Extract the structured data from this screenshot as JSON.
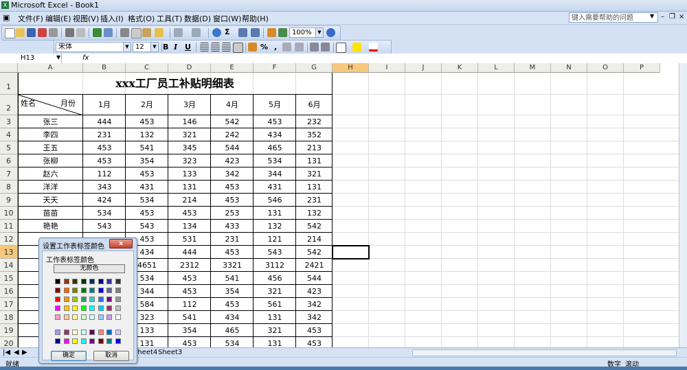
{
  "window": {
    "title": "Microsoft Excel - Book1"
  },
  "menu": {
    "items": [
      "文件(F)",
      "编辑(E)",
      "视图(V)",
      "插入(I)",
      "格式(O)",
      "工具(T)",
      "数据(D)",
      "窗口(W)",
      "帮助(H)"
    ],
    "help_placeholder": "键入需要帮助的问题"
  },
  "toolbar": {
    "zoom": "100%",
    "sum_icon": "Σ",
    "font_name": "宋体",
    "font_size": "12",
    "bold": "B",
    "italic": "I",
    "underline": "U",
    "percent": "%",
    "comma": ","
  },
  "formula_bar": {
    "name_box": "H13",
    "fx": "fx"
  },
  "columns": [
    "A",
    "B",
    "C",
    "D",
    "E",
    "F",
    "G",
    "H",
    "I",
    "J",
    "K",
    "L",
    "M",
    "N",
    "O",
    "P"
  ],
  "selected_column": "H",
  "rows": [
    "1",
    "2",
    "3",
    "4",
    "5",
    "6",
    "7",
    "8",
    "9",
    "10",
    "11",
    "12",
    "13",
    "14",
    "15",
    "16",
    "17",
    "18",
    "19",
    "20"
  ],
  "selected_row": "13",
  "sheet": {
    "title": "xxx工厂员工补贴明细表",
    "header_name": "姓名",
    "header_month": "月份",
    "month_headers": [
      "1月",
      "2月",
      "3月",
      "4月",
      "5月",
      "6月"
    ],
    "data": [
      [
        "张三",
        "444",
        "453",
        "146",
        "542",
        "453",
        "232"
      ],
      [
        "李四",
        "231",
        "132",
        "321",
        "242",
        "434",
        "352"
      ],
      [
        "王五",
        "453",
        "541",
        "345",
        "544",
        "465",
        "213"
      ],
      [
        "张柳",
        "453",
        "354",
        "323",
        "423",
        "534",
        "131"
      ],
      [
        "赵六",
        "112",
        "453",
        "133",
        "342",
        "344",
        "321"
      ],
      [
        "洋洋",
        "343",
        "431",
        "131",
        "453",
        "431",
        "131"
      ],
      [
        "天天",
        "424",
        "534",
        "214",
        "453",
        "546",
        "231"
      ],
      [
        "苗苗",
        "534",
        "453",
        "453",
        "253",
        "131",
        "132"
      ],
      [
        "艳艳",
        "543",
        "543",
        "134",
        "433",
        "132",
        "542"
      ],
      [
        "",
        "",
        "453",
        "531",
        "231",
        "121",
        "214"
      ],
      [
        "",
        "",
        "434",
        "444",
        "453",
        "543",
        "542"
      ],
      [
        "",
        "",
        "4651",
        "2312",
        "3321",
        "3112",
        "2421"
      ],
      [
        "",
        "",
        "534",
        "453",
        "541",
        "456",
        "544"
      ],
      [
        "",
        "",
        "344",
        "453",
        "354",
        "321",
        "423"
      ],
      [
        "",
        "",
        "584",
        "112",
        "453",
        "561",
        "342"
      ],
      [
        "",
        "",
        "323",
        "541",
        "434",
        "131",
        "342"
      ],
      [
        "",
        "",
        "133",
        "354",
        "465",
        "321",
        "453"
      ],
      [
        "",
        "",
        "131",
        "453",
        "534",
        "131",
        "453"
      ]
    ]
  },
  "sheet_tabs": [
    "Sheet4",
    "Sheet3"
  ],
  "status": {
    "ready": "就绪",
    "num": "数字",
    "scroll": "滚动"
  },
  "dialog": {
    "title": "设置工作表标签颜色",
    "close": "x",
    "label": "工作表标签颜色",
    "no_color": "无颜色",
    "ok": "确定",
    "cancel": "取消",
    "palette": [
      [
        "#000000",
        "#993300",
        "#333300",
        "#003300",
        "#003366",
        "#000080",
        "#333399",
        "#333333"
      ],
      [
        "#800000",
        "#ff6600",
        "#808000",
        "#008000",
        "#008080",
        "#0000ff",
        "#666699",
        "#808080"
      ],
      [
        "#ff0000",
        "#ff9900",
        "#99cc00",
        "#339966",
        "#33cccc",
        "#3366ff",
        "#800080",
        "#969696"
      ],
      [
        "#ff00ff",
        "#ffcc00",
        "#ffff00",
        "#00ff00",
        "#00ffff",
        "#00ccff",
        "#993366",
        "#c0c0c0"
      ],
      [
        "#ff99cc",
        "#ffcc99",
        "#ffff99",
        "#ccffcc",
        "#ccffff",
        "#99ccff",
        "#cc99ff",
        "#ffffff"
      ],
      [
        "#9999ff",
        "#993366",
        "#ffffcc",
        "#ccffff",
        "#660066",
        "#ff8080",
        "#0066cc",
        "#ccccff"
      ],
      [
        "#000080",
        "#ff00ff",
        "#ffff00",
        "#00ffff",
        "#800080",
        "#800000",
        "#008080",
        "#0000ff"
      ]
    ]
  }
}
